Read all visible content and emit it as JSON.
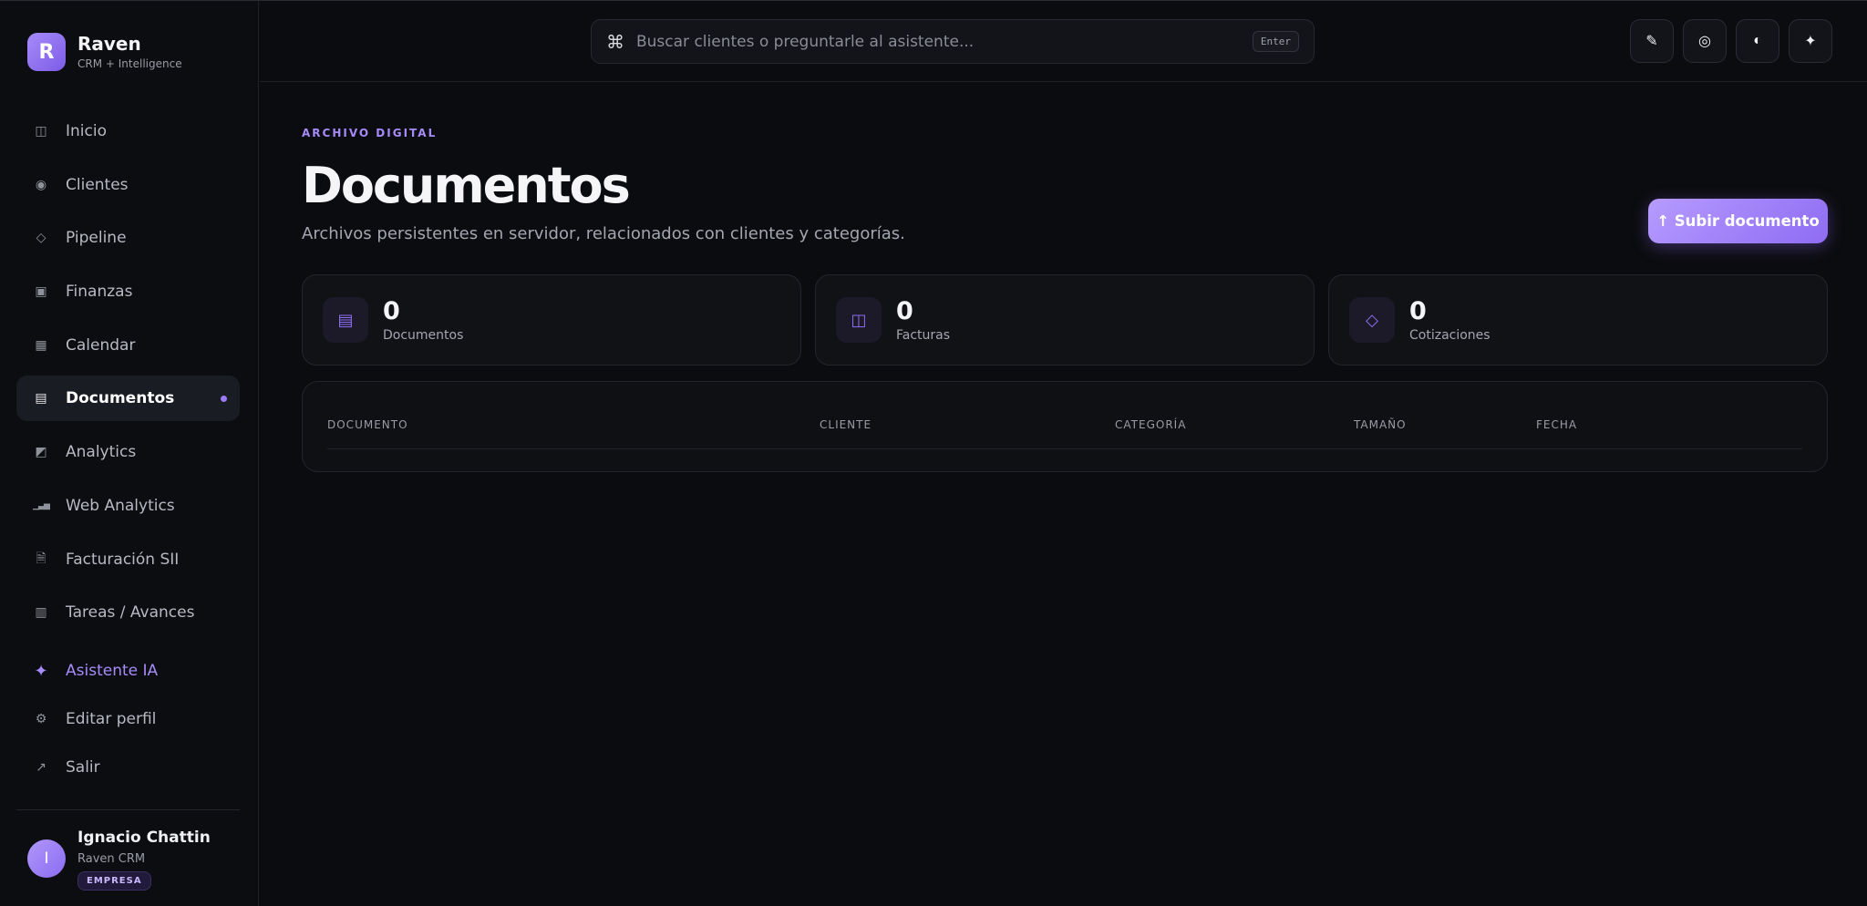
{
  "brand": {
    "logo_letter": "R",
    "name": "Raven",
    "subtitle": "CRM + Intelligence"
  },
  "nav": [
    {
      "label": "Inicio",
      "icon": "layout-icon",
      "glyph": "◫",
      "active": false
    },
    {
      "label": "Clientes",
      "icon": "target-icon",
      "glyph": "◉",
      "active": false
    },
    {
      "label": "Pipeline",
      "icon": "diamond-icon",
      "glyph": "◇",
      "active": false
    },
    {
      "label": "Finanzas",
      "icon": "square-dot-icon",
      "glyph": "▣",
      "active": false
    },
    {
      "label": "Calendar",
      "icon": "grid-icon",
      "glyph": "▦",
      "active": false
    },
    {
      "label": "Documentos",
      "icon": "list-icon",
      "glyph": "▤",
      "active": true
    },
    {
      "label": "Analytics",
      "icon": "half-square-icon",
      "glyph": "◩",
      "active": false
    },
    {
      "label": "Web Analytics",
      "icon": "bar-chart-icon",
      "glyph": "▁▃▅",
      "active": false
    },
    {
      "label": "Facturación SII",
      "icon": "file-icon",
      "glyph": "🗎",
      "active": false
    },
    {
      "label": "Tareas / Avances",
      "icon": "table-icon",
      "glyph": "▥",
      "active": false
    }
  ],
  "nav_secondary": [
    {
      "label": "Asistente IA",
      "icon": "sparkle-icon",
      "glyph": "✦"
    },
    {
      "label": "Editar perfil",
      "icon": "gear-icon",
      "glyph": "⚙"
    },
    {
      "label": "Salir",
      "icon": "arrow-out-icon",
      "glyph": "↗"
    }
  ],
  "user": {
    "initial": "I",
    "name": "Ignacio Chattin",
    "org": "Raven CRM",
    "badge": "EMPRESA"
  },
  "search": {
    "placeholder": "Buscar clientes o preguntarle al asistente...",
    "value": "",
    "key_hint": "Enter",
    "cmd_glyph": "⌘"
  },
  "top_actions": [
    {
      "name": "edit-icon",
      "glyph": "✎"
    },
    {
      "name": "target-icon",
      "glyph": "◎"
    },
    {
      "name": "contrast-icon",
      "glyph": "◐"
    },
    {
      "name": "sparkle-icon",
      "glyph": "✦"
    }
  ],
  "page": {
    "eyebrow": "ARCHIVO DIGITAL",
    "title": "Documentos",
    "description": "Archivos persistentes en servidor, relacionados con clientes y categorías.",
    "upload_label": "↑ Subir documento"
  },
  "stats": [
    {
      "value": "0",
      "label": "Documentos",
      "icon": "list-icon",
      "glyph": "▤"
    },
    {
      "value": "0",
      "label": "Facturas",
      "icon": "columns-icon",
      "glyph": "◫"
    },
    {
      "value": "0",
      "label": "Cotizaciones",
      "icon": "diamond-icon",
      "glyph": "◇"
    }
  ],
  "table": {
    "columns": [
      "DOCUMENTO",
      "CLIENTE",
      "CATEGORÍA",
      "TAMAÑO",
      "FECHA"
    ],
    "rows": []
  },
  "colors": {
    "accent": "#a78bfa",
    "background": "#0b0c0f",
    "panel": "#111216"
  }
}
